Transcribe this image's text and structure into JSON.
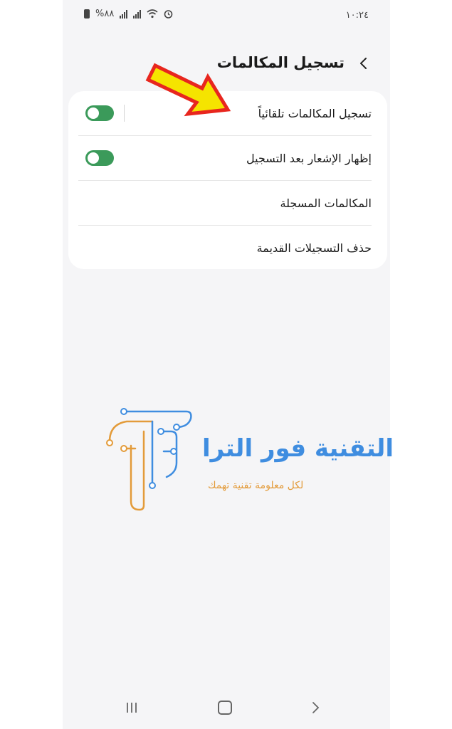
{
  "status_bar": {
    "time": "١٠:٢٤",
    "battery_text": "%٨٨"
  },
  "header": {
    "title": "تسجيل المكالمات"
  },
  "settings": {
    "items": [
      {
        "label": "تسجيل المكالمات تلقائياً",
        "toggle_on": true
      },
      {
        "label": "إظهار الإشعار بعد التسجيل",
        "toggle_on": true
      },
      {
        "label": "المكالمات المسجلة"
      },
      {
        "label": "حذف التسجيلات القديمة"
      }
    ]
  },
  "watermark": {
    "title": "التقنية فور الترا",
    "tagline": "لكل معلومة تقنية تهمك"
  },
  "colors": {
    "toggle_on": "#3b9a5a",
    "arrow_fill": "#f5e400",
    "arrow_stroke": "#e8261e",
    "logo_blue": "#3f8de0",
    "logo_orange": "#e39b3a"
  }
}
